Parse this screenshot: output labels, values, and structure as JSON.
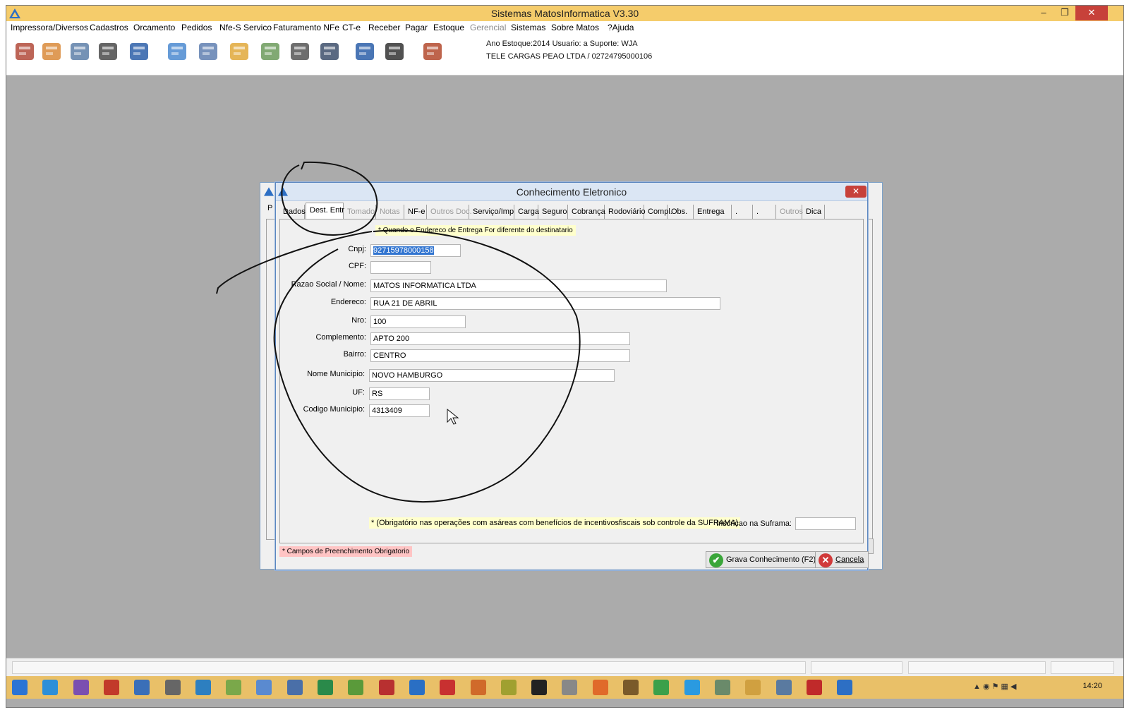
{
  "main_window": {
    "title": "Sistemas MatosInformatica V3.30",
    "controls": {
      "minimize": "–",
      "restore": "❐",
      "close": "✕"
    }
  },
  "menu": [
    {
      "label": "Impressora/Diversos",
      "enabled": true
    },
    {
      "label": "Cadastros",
      "enabled": true
    },
    {
      "label": "Orcamento",
      "enabled": true
    },
    {
      "label": "Pedidos",
      "enabled": true
    },
    {
      "label": "Nfe-S Servico",
      "enabled": true
    },
    {
      "label": "Faturamento NFe",
      "enabled": true
    },
    {
      "label": "CT-e",
      "enabled": true
    },
    {
      "label": "Receber",
      "enabled": true
    },
    {
      "label": "Pagar",
      "enabled": true
    },
    {
      "label": "Estoque",
      "enabled": true
    },
    {
      "label": "Gerencial",
      "enabled": false
    },
    {
      "label": "Sistemas",
      "enabled": true
    },
    {
      "label": "Sobre Matos",
      "enabled": true
    },
    {
      "label": "?Ajuda",
      "enabled": true
    }
  ],
  "toolbar_icons": [
    "gift-icon",
    "users-icon",
    "printer-icon",
    "stamp-icon",
    "nfse-icon",
    "handshake-icon",
    "document-icon",
    "box-icon",
    "mail-icon",
    "checklist-icon",
    "tools-icon",
    "save-icon",
    "calculator-icon",
    "exit-icon"
  ],
  "status_info": {
    "line1": "Ano Estoque:2014 Usuario: a Suporte: WJA",
    "line2": "TELE CARGAS PEAO LTDA / 02724795000106"
  },
  "dialog": {
    "title": "Conhecimento Eletronico",
    "close_glyph": "✕",
    "tabs": [
      {
        "label": "Dados",
        "enabled": true,
        "active": false
      },
      {
        "label": "Dest. Entr",
        "enabled": true,
        "active": true
      },
      {
        "label": "Tomador",
        "enabled": false,
        "active": false
      },
      {
        "label": "Notas",
        "enabled": false,
        "active": false
      },
      {
        "label": "NF-e",
        "enabled": true,
        "active": false
      },
      {
        "label": "Outros Doc.",
        "enabled": false,
        "active": false
      },
      {
        "label": "Serviço/Imp",
        "enabled": true,
        "active": false
      },
      {
        "label": "Carga",
        "enabled": true,
        "active": false
      },
      {
        "label": "Seguro",
        "enabled": true,
        "active": false
      },
      {
        "label": "Cobrança",
        "enabled": true,
        "active": false
      },
      {
        "label": "Rodoviário",
        "enabled": true,
        "active": false
      },
      {
        "label": "Compl.",
        "enabled": true,
        "active": false
      },
      {
        "label": "Obs.",
        "enabled": true,
        "active": false
      },
      {
        "label": "Entrega",
        "enabled": true,
        "active": false
      },
      {
        "label": ".",
        "enabled": true,
        "active": false
      },
      {
        "label": ".",
        "enabled": true,
        "active": false
      },
      {
        "label": "Outros",
        "enabled": false,
        "active": false
      },
      {
        "label": "Dica",
        "enabled": true,
        "active": false
      }
    ],
    "hint": "* Quando o Endereco de Entrega For diferente do destinatario",
    "fields": [
      {
        "label": "Cnpj:",
        "value": "92715978000158",
        "selected": true
      },
      {
        "label": "CPF:",
        "value": ""
      },
      {
        "label": "Razao Social / Nome:",
        "value": "MATOS INFORMATICA LTDA"
      },
      {
        "label": "Endereco:",
        "value": "RUA 21 DE ABRIL"
      },
      {
        "label": "Nro:",
        "value": "100"
      },
      {
        "label": "Complemento:",
        "value": "APTO 200"
      },
      {
        "label": "Bairro:",
        "value": "CENTRO"
      },
      {
        "label": "Nome Municipio:",
        "value": "NOVO HAMBURGO"
      },
      {
        "label": "UF:",
        "value": "RS"
      },
      {
        "label": "Codigo Municipio:",
        "value": "4313409"
      }
    ],
    "suframa_note": "* (Obrigatório nas operações com asáreas com benefícios de incentivosfiscais sob controle da SUFRAMA)",
    "suframa_label": "Inscricao na Suframa:",
    "suframa_value": "",
    "mandatory_note": "* Campos de Preenchimento Obrigatorio",
    "save_button": "Grava Conhecimento (F2)",
    "cancel_button": "Cancela",
    "save_icon": "✔",
    "cancel_icon": "✕"
  },
  "taskbar": {
    "clock": "14:20",
    "apps": [
      "start-icon",
      "ie-icon",
      "visual-studio-icon",
      "filezilla-icon",
      "app-icon",
      "app-icon",
      "app-icon",
      "app-icon",
      "app-icon",
      "app-icon",
      "app-icon",
      "app-icon",
      "opera-icon",
      "app-icon",
      "app-icon",
      "app-icon",
      "app-icon",
      "app-icon",
      "app-icon",
      "firefox-icon",
      "app-icon",
      "chrome-icon",
      "skype-icon",
      "app-icon",
      "folder-icon",
      "app-icon",
      "pdf-icon",
      "matos-icon"
    ]
  },
  "colors": {
    "title_bar": "#f5cc6b",
    "workspace": "#ababab",
    "hint_bg": "#ffffcc",
    "mandatory_bg": "#ffc4c4",
    "close_red": "#c7413a",
    "selection": "#3074d0"
  }
}
